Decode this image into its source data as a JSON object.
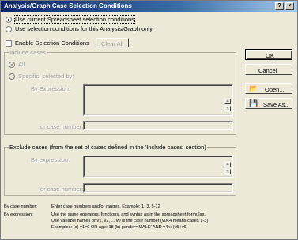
{
  "window": {
    "title": "Analysis/Graph Case Selection Conditions",
    "help_glyph": "?",
    "close_glyph": "×"
  },
  "source": {
    "opt_current": "Use current Spreadsheet selection conditions",
    "opt_analysis": "Use selection conditions for this Analysis/Graph only"
  },
  "enable": {
    "label": "Enable Selection Conditions",
    "clear_all": "Clear All"
  },
  "include": {
    "title": "Include cases",
    "all": "All",
    "specific": "Specific, selected by:",
    "by_expression": "By Expression:",
    "or_case_number": "or case number:"
  },
  "exclude": {
    "title": "Exclude cases (from the set of cases defined in the 'Include cases' section)",
    "by_expression": "By expression:",
    "or_case_number": "or case number:"
  },
  "buttons": {
    "ok": "OK",
    "cancel": "Cancel",
    "open": "Open...",
    "save_as": "Save As..."
  },
  "help": {
    "case_key": "By case number:",
    "case_val": "Enter case numbers and/or ranges.  Example:  1, 3, 5-12",
    "expr_key": "By expression:",
    "expr_line1": "Use the same operators, functions, and syntax as in the spreadsheet formulas.",
    "expr_line2": "Use variable names or v1, v2, ...   v0 is the case number  (v0<4 means cases 1-3)",
    "expr_line3": "Examples:   (a) v1=0 OR age>18   (b) gender='MALE' AND v4<>(v5+v6)"
  }
}
